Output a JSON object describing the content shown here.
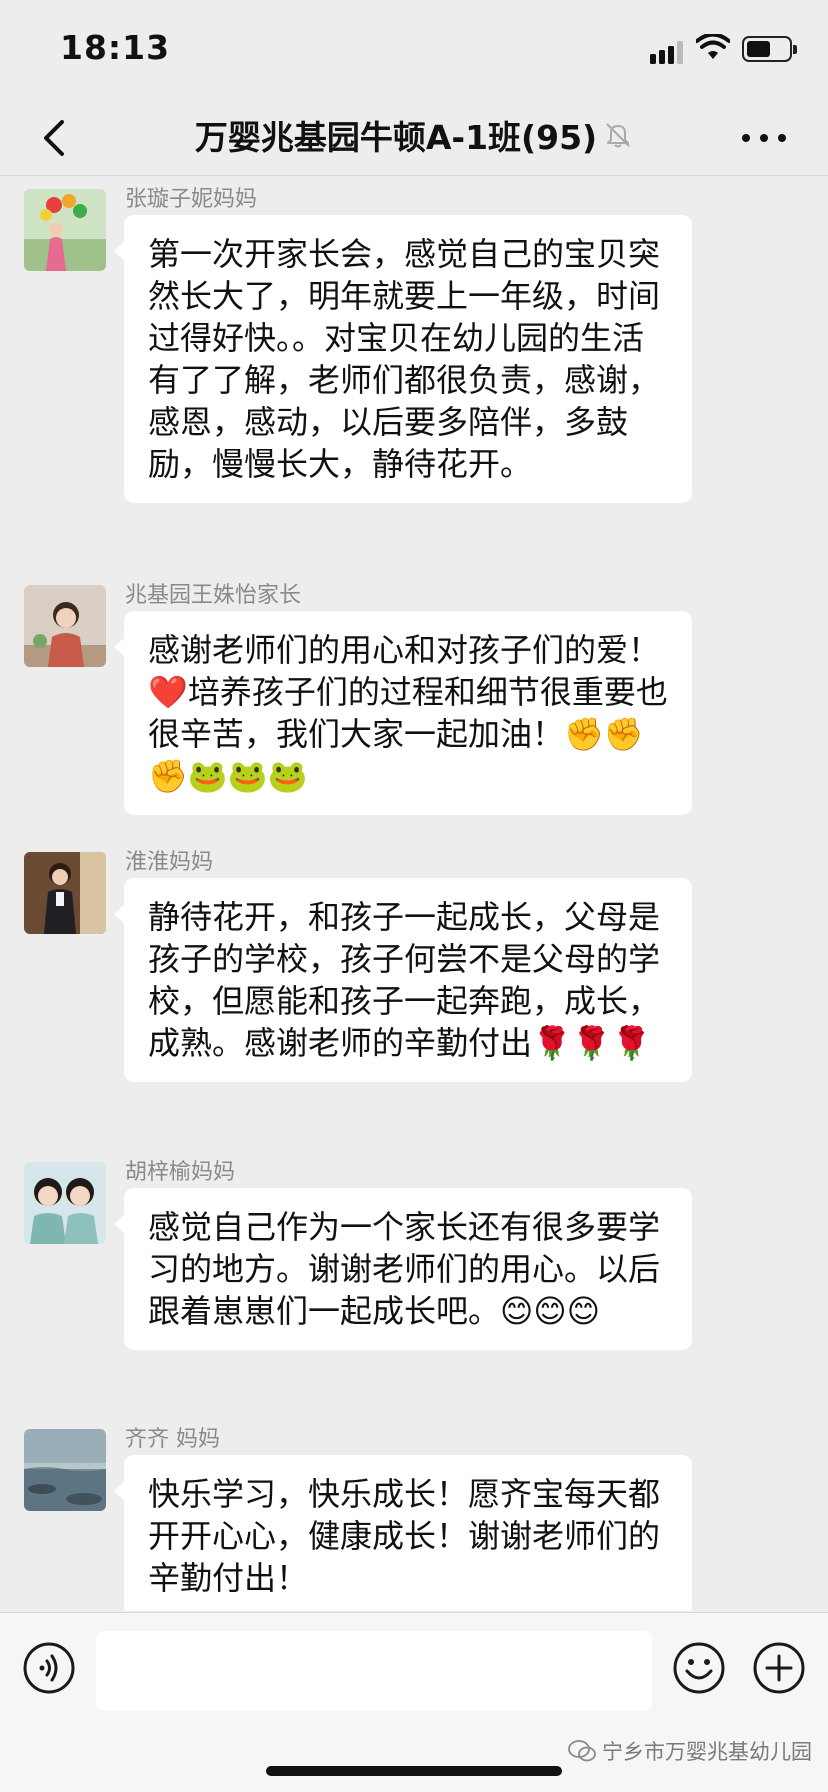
{
  "status_bar": {
    "time": "18:13",
    "battery_level": 0.55
  },
  "nav": {
    "title": "万婴兆基园牛顿A-1班(95)",
    "icons": [
      "back-arrow-icon",
      "mute-bell-icon",
      "more-dots-icon"
    ]
  },
  "messages": [
    {
      "sender": "张璇子妮妈妈",
      "text": "第一次开家长会，感觉自己的宝贝突然长大了，明年就要上一年级，时间过得好快。。对宝贝在幼儿园的生活有了了解，老师们都很负责，感谢，感恩，感动，以后要多陪伴，多鼓励，慢慢长大，静待花开。",
      "avatar_icon": "avatar-photo-balloons"
    },
    {
      "sender": "兆基园王姝怡家长",
      "text": "感谢老师们的用心和对孩子们的爱！❤️培养孩子们的过程和细节很重要也很辛苦，我们大家一起加油！✊✊✊🐸🐸🐸",
      "avatar_icon": "avatar-photo-woman"
    },
    {
      "sender": "淮淮妈妈",
      "text": "静待花开，和孩子一起成长，父母是孩子的学校，孩子何尝不是父母的学校，但愿能和孩子一起奔跑，成长，成熟。感谢老师的辛勤付出🌹🌹🌹",
      "avatar_icon": "avatar-photo-boy"
    },
    {
      "sender": "胡梓榆妈妈",
      "text": "感觉自己作为一个家长还有很多要学习的地方。谢谢老师们的用心。以后跟着崽崽们一起成长吧。😊😊😊",
      "avatar_icon": "avatar-photo-mother-daughter"
    },
    {
      "sender": "齐齐 妈妈",
      "text": "快乐学习，快乐成长！愿齐宝每天都开开心心，健康成长！谢谢老师们的辛勤付出！",
      "avatar_icon": "avatar-photo-seascape"
    }
  ],
  "input_bar": {
    "placeholder": "",
    "icons": [
      "voice-icon",
      "emoji-icon",
      "plus-icon"
    ]
  },
  "watermark": {
    "text": "宁乡市万婴兆基幼儿园",
    "icon": "wechat-official-account-icon"
  }
}
